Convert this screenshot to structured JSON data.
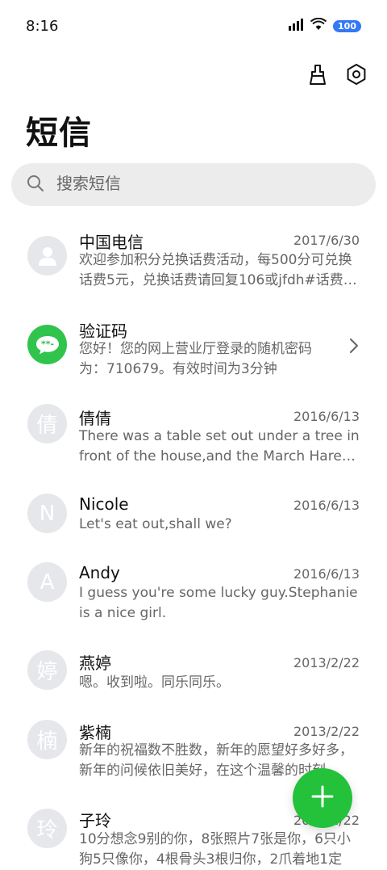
{
  "status_bar": {
    "time": "8:16",
    "battery": "100",
    "icons": [
      "signal-icon",
      "wifi-icon",
      "battery-icon"
    ]
  },
  "toolbar": {
    "icons": [
      "clean-icon",
      "settings-icon"
    ]
  },
  "page": {
    "title": "短信"
  },
  "search": {
    "placeholder": "搜索短信"
  },
  "messages": [
    {
      "name": "中国电信",
      "date": "2017/6/30",
      "preview": "欢迎参加积分兑换话费活动，每500分可兑换话费5元，兑换话费请回复106或jfdh#话费金额",
      "avatar": "person-icon"
    },
    {
      "name": "验证码",
      "date": "",
      "preview": "您好！您的网上营业厅登录的随机密码为：710679。有效时间为3分钟",
      "avatar": "message-icon",
      "has_chevron": true
    },
    {
      "name": "倩倩",
      "date": "2016/6/13",
      "preview": "There was a table set out under a tree in front of the house,and the March Hare and the Hatter",
      "avatar_text": "倩"
    },
    {
      "name": "Nicole",
      "date": "2016/6/13",
      "preview": "Let's eat out,shall we?",
      "avatar_text": "N"
    },
    {
      "name": "Andy",
      "date": "2016/6/13",
      "preview": "I guess you're some lucky guy.Stephanie is a nice girl.",
      "avatar_text": "A"
    },
    {
      "name": "燕婷",
      "date": "2013/2/22",
      "preview": "嗯。收到啦。同乐同乐。",
      "avatar_text": "婷"
    },
    {
      "name": "紫楠",
      "date": "2013/2/22",
      "preview": "新年的祝福数不胜数，新年的愿望好多好多，新年的问候依旧美好，在这个温馨的时刻",
      "avatar_text": "楠"
    },
    {
      "name": "子玲",
      "date": "2013/2/22",
      "preview": "10分想念9别的你，8张照片7张是你，6只小狗5只像你，4根骨头3根归你，2爪着地1定",
      "avatar_text": "玲"
    }
  ],
  "fab": {
    "icon": "plus-icon"
  },
  "colors": {
    "accent_green": "#23c23a",
    "avatar_bg": "#e6e7ea",
    "search_bg": "#ececec",
    "battery_blue": "#3478f6"
  }
}
